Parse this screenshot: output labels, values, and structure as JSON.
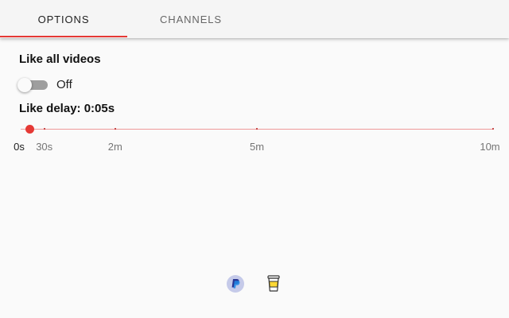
{
  "tabs": [
    {
      "label": "OPTIONS",
      "active": true
    },
    {
      "label": "CHANNELS",
      "active": false
    }
  ],
  "options": {
    "like_all": {
      "heading": "Like all videos",
      "toggle_state": "Off",
      "enabled": false
    },
    "like_delay": {
      "heading": "Like delay: 0:05s",
      "slider": {
        "value_seconds": 5,
        "max_seconds": 600,
        "marks": [
          {
            "label": "0s",
            "seconds": 0
          },
          {
            "label": "30s",
            "seconds": 30
          },
          {
            "label": "2m",
            "seconds": 120
          },
          {
            "label": "5m",
            "seconds": 300
          },
          {
            "label": "10m",
            "seconds": 600
          }
        ]
      }
    }
  },
  "footer": {
    "icons": [
      "paypal-icon",
      "coffee-cup-icon"
    ]
  },
  "colors": {
    "accent": "#e53935",
    "accent_light": "#ef9a9a",
    "switch_off_track": "#9e9e9e"
  }
}
